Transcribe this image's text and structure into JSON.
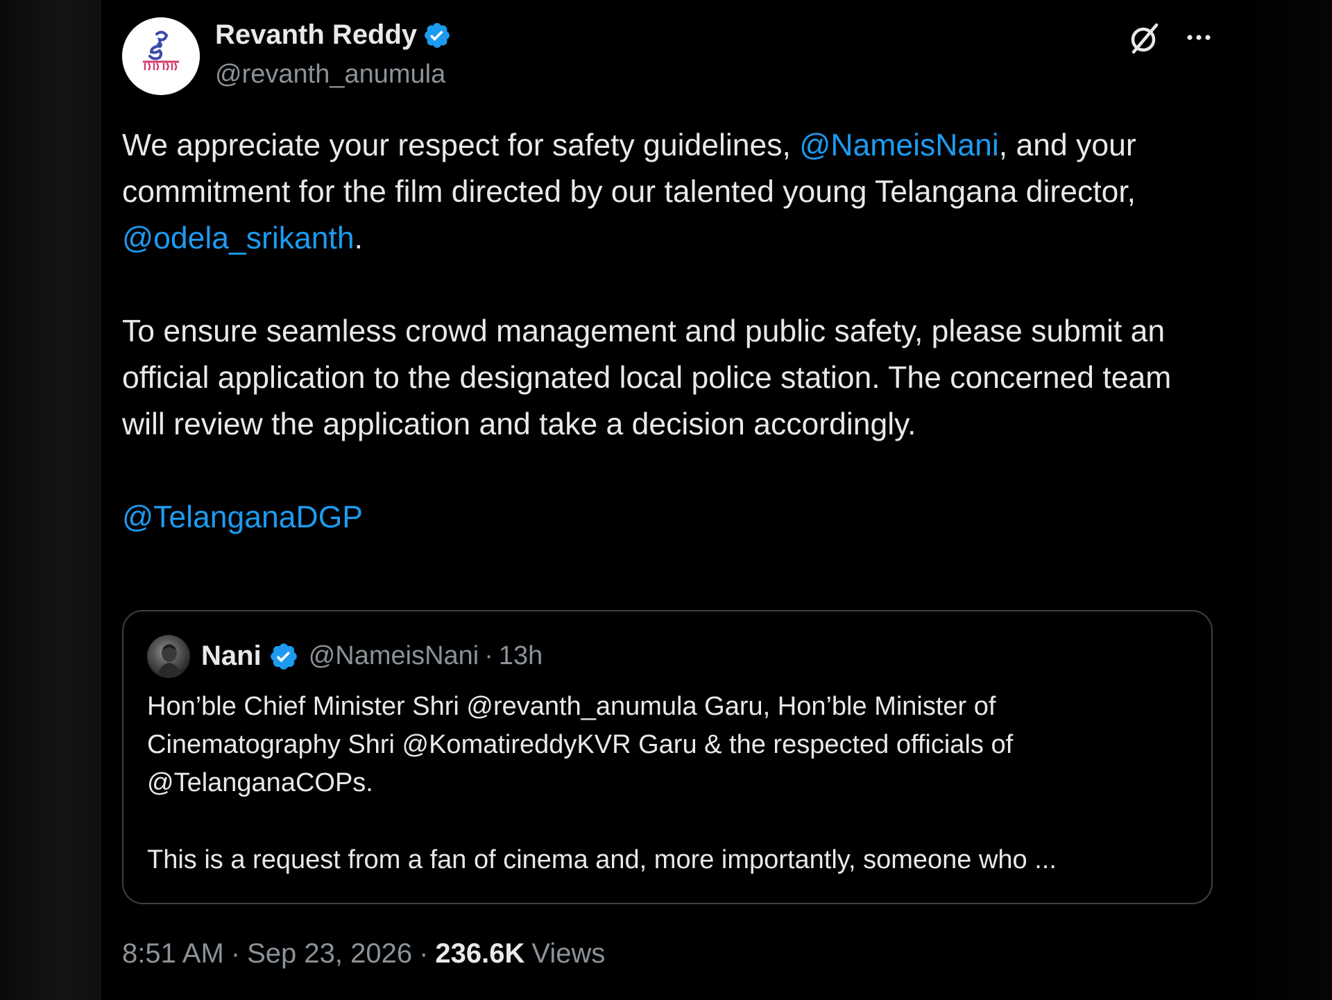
{
  "author": {
    "name": "Revanth Reddy",
    "handle": "@revanth_anumula"
  },
  "tweet": {
    "p1_a": "We appreciate your respect for safety guidelines, ",
    "p1_mention1": "@NameisNani",
    "p1_b": ", and your commitment for the film directed by our talented young Telangana director, ",
    "p1_mention2": "@odela_srikanth",
    "p1_c": ".",
    "p2": "To ensure seamless crowd management and public safety, please submit an official application to the designated local police station. The concerned team will review the application and take a decision accordingly.",
    "p3_mention": "@TelanganaDGP"
  },
  "quote": {
    "name": "Nani",
    "handle": "@NameisNani",
    "separator": "·",
    "time": "13h",
    "text1": "Hon’ble Chief Minister Shri @revanth_anumula Garu, Hon’ble Minister of Cinematography Shri @KomatireddyKVR Garu & the respected officials of @TelanganaCOPs.",
    "text2": "This is a request from a fan of cinema and, more importantly, someone who ..."
  },
  "meta": {
    "time": "8:51 AM",
    "dot1": "·",
    "date": "Sep 23, 2026",
    "dot2": "·",
    "views_count": "236.6K",
    "views_label": "Views"
  },
  "colors": {
    "background": "#000000",
    "text": "#e7e9ea",
    "secondary": "#8b9298",
    "link": "#1d9bf0",
    "verified": "#1d9bf0",
    "border": "#3e4144"
  },
  "icons": {
    "verified": "verified-badge-icon",
    "grok": "grok-icon",
    "more": "more-options-icon"
  }
}
